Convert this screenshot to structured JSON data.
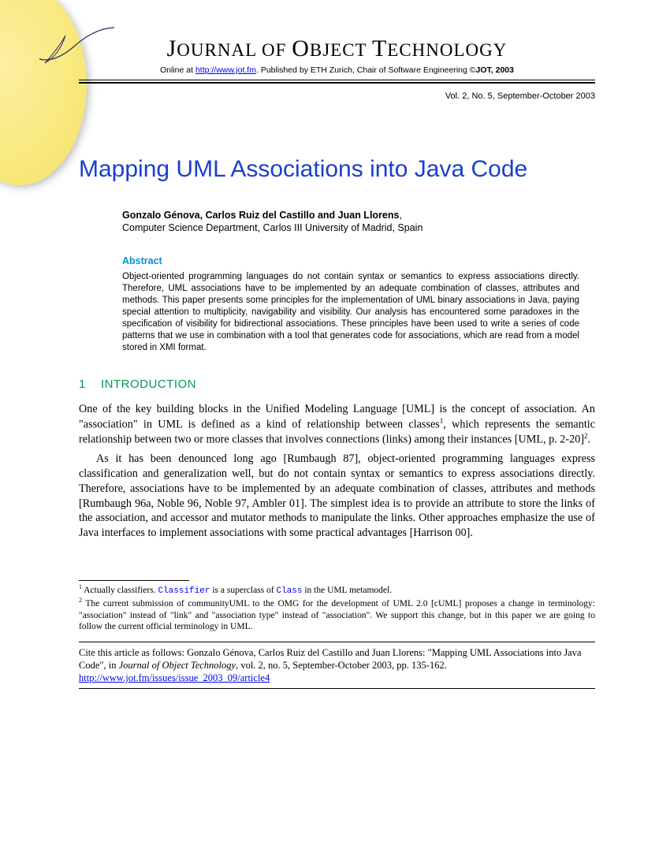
{
  "journal": {
    "title_upper": "JOURNAL OF OBJECT TECHNOLOGY",
    "online_prefix": "Online at ",
    "online_url": "http://www.jot.fm",
    "online_suffix": ". Published by ETH Zurich, Chair of Software Engineering ©",
    "jot_bold": "JOT, 2003",
    "vol_info": "Vol. 2, No. 5, September-October 2003"
  },
  "article": {
    "title": "Mapping UML Associations into Java Code",
    "authors_names": "Gonzalo Génova, Carlos Ruiz del Castillo and Juan Llorens",
    "authors_affiliation": "Computer Science Department, Carlos III University of Madrid, Spain",
    "abstract_heading": "Abstract",
    "abstract_text": "Object-oriented programming languages do not contain syntax or semantics to express associations directly. Therefore, UML associations have to be implemented by an adequate combination of classes, attributes and methods. This paper presents some principles for the implementation of UML binary associations in Java, paying special attention to multiplicity, navigability and visibility. Our analysis has encountered some paradoxes in the specification of visibility for bidirectional associations. These principles have been used to write a series of code patterns that we use in combination with a tool that generates code for associations, which are read from a model stored in XMI format."
  },
  "section": {
    "num": "1",
    "title": "INTRODUCTION",
    "para1_a": "One of the key building blocks in the Unified Modeling Language [UML] is the concept of association. An \"association\" in UML is defined as a kind of relationship between classes",
    "para1_b": ", which represents the semantic relationship between two or more classes that involves connections (links) among their instances [UML, p. 2-20]",
    "para1_c": ".",
    "para2": "As it has been denounced long ago [Rumbaugh 87], object-oriented programming languages express classification and generalization well, but do not contain syntax or semantics to express associations directly. Therefore, associations have to be implemented by an adequate combination of classes, attributes and methods [Rumbaugh 96a, Noble 96, Noble 97, Ambler 01]. The simplest idea is to provide an attribute to store the links of the association, and accessor and mutator methods to manipulate the links. Other approaches emphasize the use of Java interfaces to implement associations with some practical advantages [Harrison 00]."
  },
  "footnotes": {
    "f1_a": " Actually classifiers. ",
    "f1_code1": "Classifier",
    "f1_b": " is a superclass of ",
    "f1_code2": "Class",
    "f1_c": " in the UML metamodel.",
    "f2": " The current submission of communityUML to the OMG for the development of UML 2.0 [cUML] proposes a change in terminology: \"association\" instead of \"link\" and \"association type\" instead of \"association\". We support this change, but in this paper we are going to follow the current official terminology in UML."
  },
  "citation": {
    "prefix": "Cite this article as follows: Gonzalo Génova, Carlos Ruiz del Castillo and Juan Llorens: \"Mapping UML Associations into Java Code\", in ",
    "journal_ital": "Journal of Object Technology",
    "suffix": ", vol. 2, no. 5, September-October 2003, pp. 135-162. ",
    "url": "http://www.jot.fm/issues/issue_2003_09/article4"
  }
}
